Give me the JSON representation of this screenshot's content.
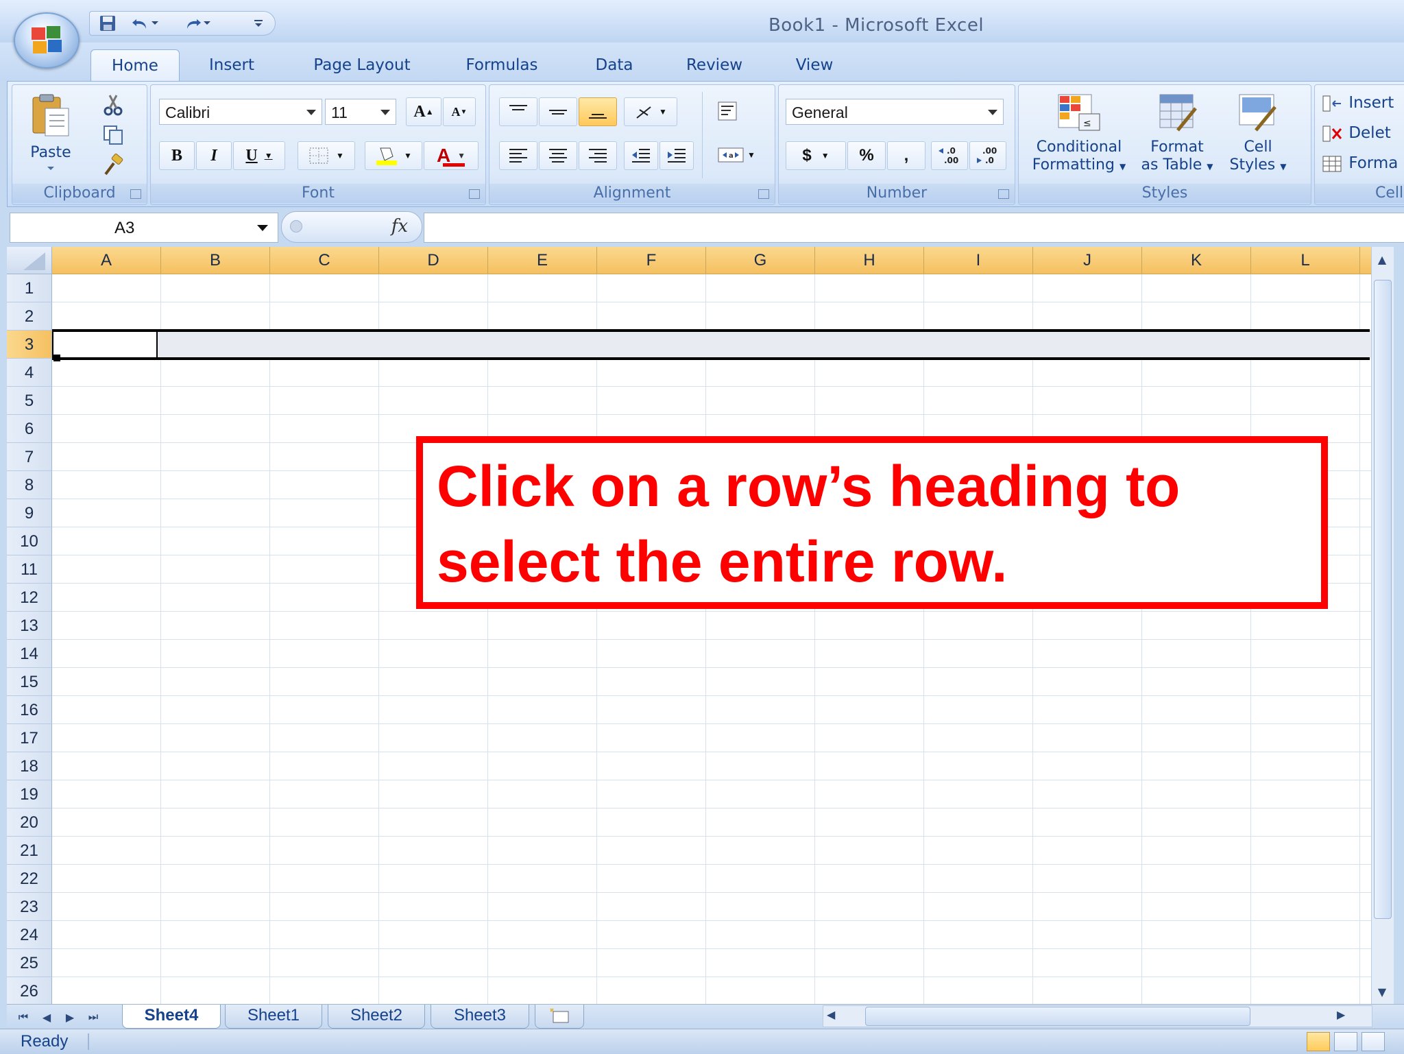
{
  "window": {
    "title": "Book1 - Microsoft Excel"
  },
  "ribbon": {
    "tabs": [
      "Home",
      "Insert",
      "Page Layout",
      "Formulas",
      "Data",
      "Review",
      "View"
    ],
    "active_tab": "Home",
    "clipboard": {
      "paste_label": "Paste",
      "group_label": "Clipboard"
    },
    "font": {
      "family": "Calibri",
      "size": "11",
      "bold": "B",
      "italic": "I",
      "underline": "U",
      "grow": "A",
      "shrink": "A",
      "color_glyph": "A",
      "group_label": "Font"
    },
    "alignment": {
      "group_label": "Alignment"
    },
    "number": {
      "format": "General",
      "currency": "$",
      "percent": "%",
      "comma": ",",
      "group_label": "Number"
    },
    "styles": {
      "conditional_line1": "Conditional",
      "conditional_line2": "Formatting",
      "format_table_line1": "Format",
      "format_table_line2": "as Table",
      "cell_styles_line1": "Cell",
      "cell_styles_line2": "Styles",
      "group_label": "Styles"
    },
    "cells": {
      "insert": "Insert",
      "delete": "Delet",
      "format": "Forma",
      "group_label": "Cells"
    }
  },
  "formula_bar": {
    "name_box": "A3",
    "fx": "fx",
    "value": ""
  },
  "grid": {
    "columns": [
      "A",
      "B",
      "C",
      "D",
      "E",
      "F",
      "G",
      "H",
      "I",
      "J",
      "K",
      "L"
    ],
    "rows": [
      "1",
      "2",
      "3",
      "4",
      "5",
      "6",
      "7",
      "8",
      "9",
      "10",
      "11",
      "12",
      "13",
      "14",
      "15",
      "16",
      "17",
      "18",
      "19",
      "20",
      "21",
      "22",
      "23",
      "24",
      "25",
      "26"
    ],
    "selected_row": "3",
    "active_cell": "A3"
  },
  "sheet_tabs": [
    "Sheet4",
    "Sheet1",
    "Sheet2",
    "Sheet3"
  ],
  "active_sheet": "Sheet4",
  "status": {
    "text": "Ready"
  },
  "callout": {
    "line1": "Click on a row’s heading to",
    "line2": "select the entire row."
  },
  "colors": {
    "accent_orange": "#f5c060",
    "callout_red": "#ff0000",
    "ribbon_blue": "#c5d9f1"
  }
}
